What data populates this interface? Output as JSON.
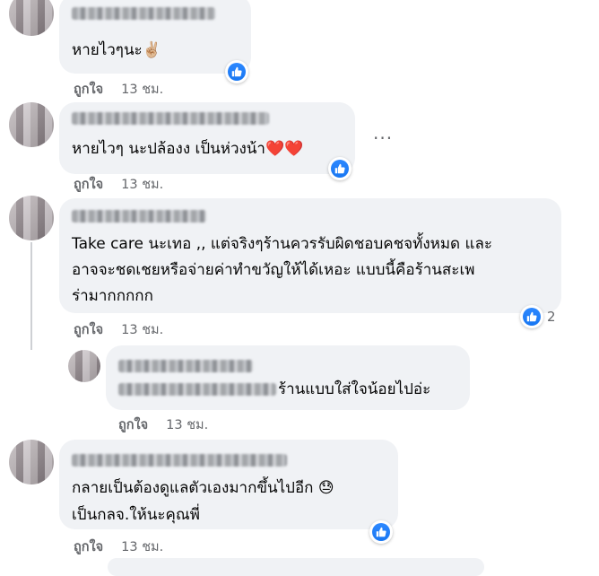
{
  "comments": [
    {
      "text": "หายไวๆนะ✌🏼",
      "like_label": "ถูกใจ",
      "time": "13 ชม.",
      "reactions": "like"
    },
    {
      "text": "หายไวๆ นะปล้องง เป็นห่วงน้า❤️❤️",
      "like_label": "ถูกใจ",
      "time": "13 ชม.",
      "reactions": "like",
      "more": "..."
    },
    {
      "line1": "Take care นะเทอ ,, แต่จริงๆร้านควรรับผิดชอบคชจทั้งหมด และ",
      "line2": "อาจจะชดเชยหรือจ่ายค่าทำขวัญให้ได้เหอะ แบบนี้คือร้านสะเพ",
      "line3": "ร่ามากกกกก",
      "like_label": "ถูกใจ",
      "time": "13 ชม.",
      "reactions": "like",
      "reaction_count": "2"
    },
    {
      "text": "ร้านแบบใส่ใจน้อยไปอ่ะ",
      "like_label": "ถูกใจ",
      "time": "13 ชม."
    },
    {
      "line1": "กลายเป็นต้องดูแลตัวเองมากขึ้นไปอีก 😓",
      "line2": "เป็นกลจ.ให้นะคุณพี่",
      "like_label": "ถูกใจ",
      "time": "13 ชม.",
      "reactions": "like"
    }
  ],
  "icons": {
    "like": "thumbs-up-icon",
    "more": "more-options-icon"
  },
  "colors": {
    "bubble": "#f0f2f5",
    "like_blue": "#1877f2",
    "meta_text": "#65676b"
  }
}
